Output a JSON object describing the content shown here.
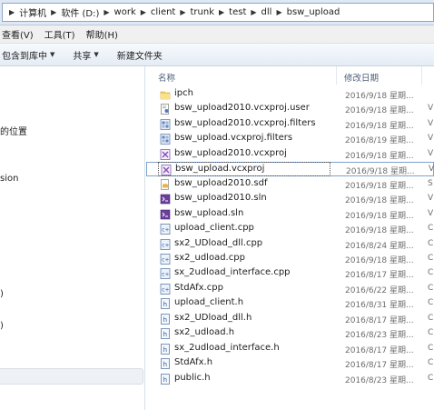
{
  "breadcrumb": [
    "计算机",
    "软件 (D:)",
    "work",
    "client",
    "trunk",
    "test",
    "dll",
    "bsw_upload"
  ],
  "menu": [
    "查看(V)",
    "工具(T)",
    "帮助(H)"
  ],
  "toolbar": {
    "include_library": "包含到库中",
    "share": "共享",
    "new_folder": "新建文件夹"
  },
  "nav": {
    "item_recent": "的位置",
    "item_sion": "sion",
    "item_paren1": ")",
    "item_paren2": ")"
  },
  "columns": {
    "name": "名称",
    "modified": "修改日期",
    "type": ""
  },
  "files": [
    {
      "name": "ipch",
      "date": "2016/9/18 星期...",
      "type": "",
      "icon": "folder-icon"
    },
    {
      "name": "bsw_upload2010.vcxproj.user",
      "date": "2016/9/18 星期...",
      "type": "V",
      "icon": "user-file-icon"
    },
    {
      "name": "bsw_upload2010.vcxproj.filters",
      "date": "2016/9/18 星期...",
      "type": "V",
      "icon": "filters-file-icon"
    },
    {
      "name": "bsw_upload.vcxproj.filters",
      "date": "2016/8/19 星期...",
      "type": "V",
      "icon": "filters-file-icon"
    },
    {
      "name": "bsw_upload2010.vcxproj",
      "date": "2016/9/18 星期...",
      "type": "V",
      "icon": "vcxproj-file-icon"
    },
    {
      "name": "bsw_upload.vcxproj",
      "date": "2016/9/18 星期...",
      "type": "V",
      "icon": "vcxproj-file-icon"
    },
    {
      "name": "bsw_upload2010.sdf",
      "date": "2016/9/18 星期...",
      "type": "S",
      "icon": "sdf-file-icon"
    },
    {
      "name": "bsw_upload2010.sln",
      "date": "2016/9/18 星期...",
      "type": "V",
      "icon": "sln-file-icon"
    },
    {
      "name": "bsw_upload.sln",
      "date": "2016/9/18 星期...",
      "type": "V",
      "icon": "sln-file-icon"
    },
    {
      "name": "upload_client.cpp",
      "date": "2016/9/18 星期...",
      "type": "C",
      "icon": "cpp-file-icon"
    },
    {
      "name": "sx2_UDload_dll.cpp",
      "date": "2016/8/24 星期...",
      "type": "C",
      "icon": "cpp-file-icon"
    },
    {
      "name": "sx2_udload.cpp",
      "date": "2016/9/18 星期...",
      "type": "C",
      "icon": "cpp-file-icon"
    },
    {
      "name": "sx_2udload_interface.cpp",
      "date": "2016/8/17 星期...",
      "type": "C",
      "icon": "cpp-file-icon"
    },
    {
      "name": "StdAfx.cpp",
      "date": "2016/6/22 星期...",
      "type": "C",
      "icon": "cpp-file-icon"
    },
    {
      "name": "upload_client.h",
      "date": "2016/8/31 星期...",
      "type": "C",
      "icon": "header-file-icon"
    },
    {
      "name": "sx2_UDload_dll.h",
      "date": "2016/8/17 星期...",
      "type": "C",
      "icon": "header-file-icon"
    },
    {
      "name": "sx2_udload.h",
      "date": "2016/8/23 星期...",
      "type": "C",
      "icon": "header-file-icon"
    },
    {
      "name": "sx_2udload_interface.h",
      "date": "2016/8/17 星期...",
      "type": "C",
      "icon": "header-file-icon"
    },
    {
      "name": "StdAfx.h",
      "date": "2016/8/17 星期...",
      "type": "C",
      "icon": "header-file-icon"
    },
    {
      "name": "public.h",
      "date": "2016/8/23 星期...",
      "type": "C",
      "icon": "header-file-icon"
    }
  ],
  "selected_file": "bsw_upload.vcxproj"
}
